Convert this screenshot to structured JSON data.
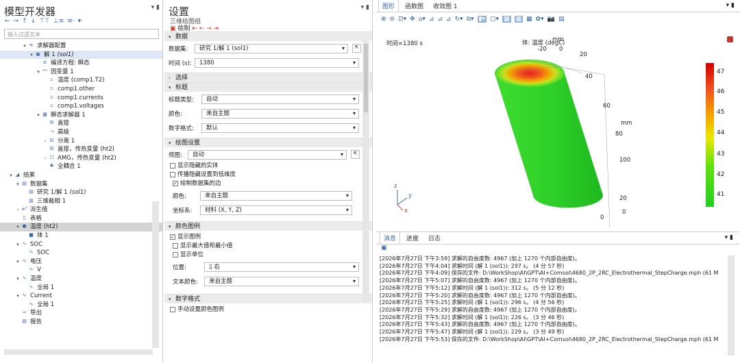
{
  "model_builder": {
    "title": "模型开发器",
    "search_placeholder": "输入过滤文本",
    "toolbar": [
      "←",
      "→",
      "↑",
      "↓",
      "⊤⊤",
      "⊥≡",
      "≡·",
      "▾·"
    ],
    "tree": [
      {
        "indent": 3,
        "tw": "▾",
        "icon": "≋",
        "label": "求解器配置"
      },
      {
        "indent": 4,
        "tw": "▾",
        "icon": "▣",
        "label": "解 1",
        "suffix": "(sol1)",
        "selected": true
      },
      {
        "indent": 5,
        "tw": "",
        "icon": "≡",
        "label": "编译方程: 瞬态"
      },
      {
        "indent": 5,
        "tw": "▾",
        "icon": "ʷʷ",
        "label": "因变量 1"
      },
      {
        "indent": 6,
        "tw": "",
        "icon": "▫",
        "label": "温度 (comp1.T2)"
      },
      {
        "indent": 6,
        "tw": "",
        "icon": "▫",
        "label": "comp1.other"
      },
      {
        "indent": 6,
        "tw": "",
        "icon": "▫",
        "label": "comp1.currents"
      },
      {
        "indent": 6,
        "tw": "",
        "icon": "▫",
        "label": "comp1.voltages"
      },
      {
        "indent": 5,
        "tw": "▾",
        "icon": "▦",
        "label": "瞬态求解器 1"
      },
      {
        "indent": 6,
        "tw": "",
        "icon": "☒",
        "label": "直接"
      },
      {
        "indent": 6,
        "tw": "",
        "icon": "⇢",
        "label": "高级"
      },
      {
        "indent": 6,
        "tw": "›",
        "icon": "⊟",
        "label": "分离 1"
      },
      {
        "indent": 6,
        "tw": "",
        "icon": "☒",
        "label": "直接，传热变量 (ht2)"
      },
      {
        "indent": 6,
        "tw": "›",
        "icon": "☐",
        "label": "AMG，传热变量 (ht2)"
      },
      {
        "indent": 6,
        "tw": "",
        "icon": "✚",
        "label": "全耦合 1"
      },
      {
        "indent": 1,
        "tw": "▾",
        "icon": "◢",
        "label": "结果"
      },
      {
        "indent": 2,
        "tw": "▾",
        "icon": "▤",
        "label": "数据集"
      },
      {
        "indent": 3,
        "tw": "",
        "icon": "▤",
        "label": "研究 1/解 1",
        "suffix": "(sol1)"
      },
      {
        "indent": 3,
        "tw": "",
        "icon": "▥",
        "label": "三维截相 1"
      },
      {
        "indent": 2,
        "tw": "›",
        "icon": "±⁰",
        "label": "派生值"
      },
      {
        "indent": 2,
        "tw": "",
        "icon": "▯",
        "label": "表格"
      },
      {
        "indent": 2,
        "tw": "▾",
        "icon": "●",
        "label": "温度 (ht2)",
        "selected2": true
      },
      {
        "indent": 3,
        "tw": "",
        "icon": "■",
        "label": "体 1"
      },
      {
        "indent": 2,
        "tw": "▾",
        "icon": "∿",
        "label": "SOC"
      },
      {
        "indent": 3,
        "tw": "",
        "icon": "∿",
        "label": "SOC"
      },
      {
        "indent": 2,
        "tw": "▾",
        "icon": "∿",
        "label": "电压"
      },
      {
        "indent": 3,
        "tw": "",
        "icon": "∿",
        "label": "V"
      },
      {
        "indent": 2,
        "tw": "▾",
        "icon": "∿",
        "label": "温度"
      },
      {
        "indent": 3,
        "tw": "",
        "icon": "∿",
        "label": "全局 1"
      },
      {
        "indent": 2,
        "tw": "▾",
        "icon": "∿",
        "label": "Current"
      },
      {
        "indent": 3,
        "tw": "",
        "icon": "∿",
        "label": "全局 1"
      },
      {
        "indent": 2,
        "tw": "",
        "icon": "⇨",
        "label": "导出"
      },
      {
        "indent": 2,
        "tw": "",
        "icon": "▤",
        "label": "报告"
      }
    ]
  },
  "settings": {
    "title": "设置",
    "subtitle": "三维绘图组",
    "toolbar_label": "绘制",
    "sections": {
      "data": "数据",
      "selection": "选择",
      "title": "标题",
      "plot_settings": "绘图设置",
      "color_legend": "颜色图例",
      "number_format": "数字格式"
    },
    "dataset_label": "数据集:",
    "dataset_value": "研究 1/解 1 (sol1)",
    "time_label": "时间 (s):",
    "time_value": "1380",
    "title_type_label": "标题类型:",
    "title_type_value": "自动",
    "color_label": "颜色:",
    "color_value": "来自主题",
    "font_style_label": "数字格式:",
    "font_style_value": "默认",
    "view_label": "视图:",
    "view_value": "自动",
    "show_hidden_entities": "显示隐藏的实体",
    "propagate_hiding": "传播隐藏设置到低维度",
    "plot_dataset_edges": "绘制数据集的边",
    "edge_color_label": "颜色:",
    "edge_color_value": "来自主题",
    "frame_label": "坐标系:",
    "frame_value": "材料 (X, Y, Z)",
    "show_legend": "显示图例",
    "show_maxmin": "显示最大值和最小值",
    "show_units": "显示单位",
    "position_label": "位置:",
    "position_value": "右",
    "text_color_label": "文本颜色:",
    "text_color_value": "来自主题",
    "manual_color_legend": "手动设置颜色图例"
  },
  "graphics": {
    "tabs": [
      "图形",
      "函数图",
      "收敛图 1"
    ],
    "time_readout": "时间=1380 s",
    "plot_title": "体: 温度 (degC)",
    "unit_mm": "mm",
    "axis_ticks_top": [
      "-20",
      "0",
      "20"
    ],
    "axis_ticks_right": [
      "40",
      "60",
      "80",
      "100"
    ],
    "axis_ticks_bottom": [
      "20",
      "0"
    ],
    "axis_ticks_left": [
      "0"
    ],
    "axis_labels": [
      "z",
      "y",
      "x"
    ],
    "color_scale_ticks": [
      "47",
      "46",
      "45",
      "44",
      "43",
      "42",
      "41"
    ],
    "colors": {
      "hot": "#e52222",
      "mid": "#f4a000",
      "cold": "#2bd128"
    }
  },
  "messages": {
    "tabs": [
      "消息",
      "进度",
      "日志"
    ],
    "lines": [
      "[2026年7月27日 下午3:59] 求解的自由度数: 4967 (加上 1270 个内部自由度)。",
      "[2026年7月27日 下午4:04] 求解时间 (解 1 (sol1)): 297 s。 (4 分 57 秒)",
      "[2026年7月27日 下午4:09] 保存的文件: D:\\WorkShop\\AI\\GPT\\AI+Comsol\\4680_2P_2RC_Electrothermal_StepCharge.mph (61 M",
      "[2026年7月27日 下午5:07] 求解的自由度数: 4967 (加上 1270 个内部自由度)。",
      "[2026年7月27日 下午5:12] 求解时间 (解 1 (sol1)): 312 s。 (5 分 12 秒)",
      "[2026年7月27日 下午5:20] 求解的自由度数: 4967 (加上 1270 个内部自由度)。",
      "[2026年7月27日 下午5:25] 求解时间 (解 1 (sol1)): 296 s。 (4 分 56 秒)",
      "[2026年7月27日 下午5:29] 求解的自由度数: 4967 (加上 1270 个内部自由度)。",
      "[2026年7月27日 下午5:32] 求解时间 (解 1 (sol1)): 226 s。 (3 分 46 秒)",
      "[2026年7月27日 下午5:43] 求解的自由度数: 4967 (加上 1270 个内部自由度)。",
      "[2026年7月27日 下午5:47] 求解时间 (解 1 (sol1)): 229 s。 (3 分 49 秒)",
      "[2026年7月27日 下午5:53] 保存的文件: D:\\WorkShop\\AI\\GPT\\AI+Comsol\\4680_2P_2RC_Electrothermal_StepCharge.mph (61 M"
    ]
  }
}
